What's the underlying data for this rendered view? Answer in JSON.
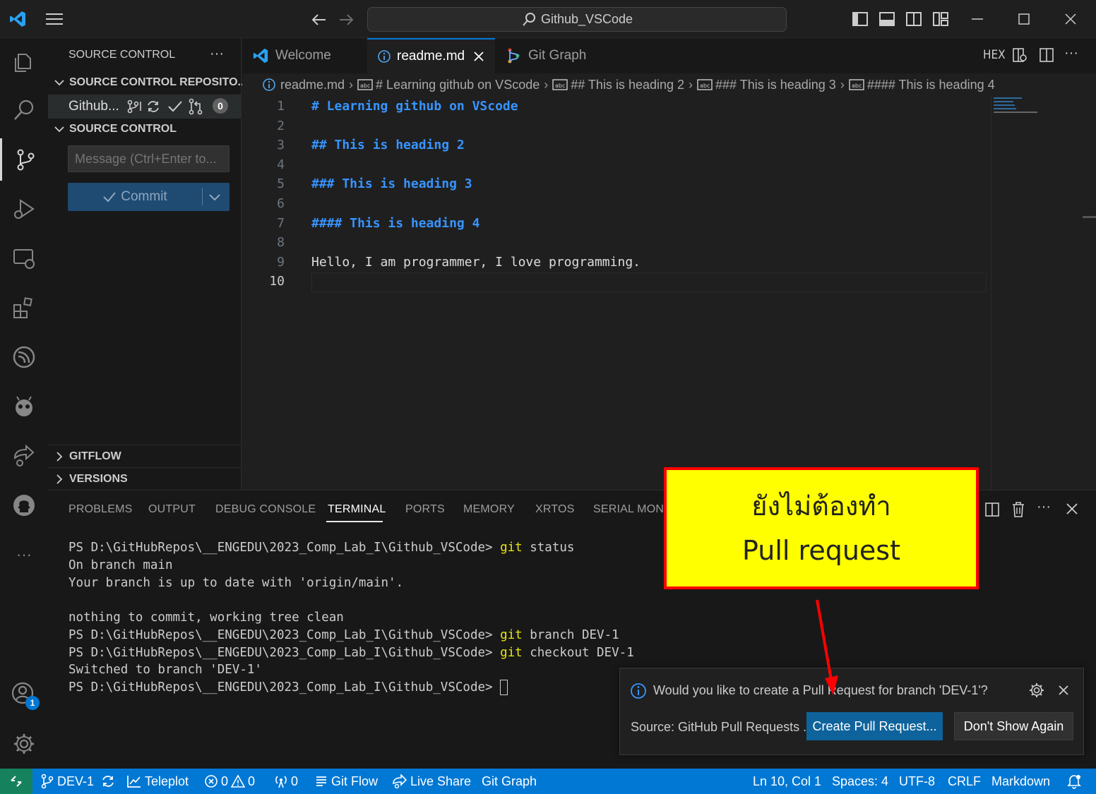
{
  "titlebar": {
    "search_text": "Github_VSCode"
  },
  "sidebar": {
    "title": "SOURCE CONTROL",
    "more": "···",
    "repos_header": "SOURCE CONTROL REPOSITO...",
    "repo_name": "Github...",
    "repo_badge": "0",
    "scm_header": "SOURCE CONTROL",
    "message_placeholder": "Message (Ctrl+Enter to...",
    "commit_label": "Commit",
    "gitflow": "GITFLOW",
    "versions": "VERSIONS"
  },
  "tabs": [
    {
      "label": "Welcome"
    },
    {
      "label": "readme.md"
    },
    {
      "label": "Git Graph"
    }
  ],
  "editor_actions": {
    "hex": "HEX"
  },
  "breadcrumb": {
    "file": "readme.md",
    "h1": "# Learning github on VScode",
    "h2": "## This is heading 2",
    "h3": "### This is heading 3",
    "h4": "#### This is heading 4"
  },
  "code_lines": [
    {
      "num": "1",
      "text": "# Learning github on VScode"
    },
    {
      "num": "2",
      "text": ""
    },
    {
      "num": "3",
      "text": "## This is heading 2"
    },
    {
      "num": "4",
      "text": ""
    },
    {
      "num": "5",
      "text": "### This is heading 3"
    },
    {
      "num": "6",
      "text": ""
    },
    {
      "num": "7",
      "text": "#### This is heading 4"
    },
    {
      "num": "8",
      "text": ""
    },
    {
      "num": "9",
      "text": "Hello, I am programmer, I love programming."
    },
    {
      "num": "10",
      "text": ""
    }
  ],
  "panel": {
    "tabs": [
      "PROBLEMS",
      "OUTPUT",
      "DEBUG CONSOLE",
      "TERMINAL",
      "PORTS",
      "MEMORY",
      "XRTOS",
      "SERIAL MONIT"
    ],
    "more": "···"
  },
  "terminal": {
    "prompt": "PS D:\\GitHubRepos\\__ENGEDU\\2023_Comp_Lab_I\\Github_VSCode>",
    "git": "git",
    "cmd1_rest": " status",
    "out1": "On branch main",
    "out2": "Your branch is up to date with 'origin/main'.",
    "out3": "nothing to commit, working tree clean",
    "cmd2_rest": " branch DEV-1",
    "cmd3_rest": " checkout DEV-1",
    "out4": "Switched to branch 'DEV-1'"
  },
  "callout": {
    "line1": "ยังไม่ต้องทำ",
    "line2": "Pull request"
  },
  "notification": {
    "message": "Would you like to create a Pull Request for branch 'DEV-1'?",
    "source": "Source: GitHub Pull Requests ...",
    "primary": "Create Pull Request...",
    "secondary": "Don't Show Again"
  },
  "statusbar": {
    "branch": "DEV-1",
    "teleplot": "Teleplot",
    "errors": "0",
    "warnings": "0",
    "ports": "0",
    "gitflow": "Git Flow",
    "liveshare": "Live Share",
    "gitgraph": "Git Graph",
    "position": "Ln 10, Col 1",
    "spaces": "Spaces: 4",
    "encoding": "UTF-8",
    "eol": "CRLF",
    "language": "Markdown"
  },
  "accounts_badge": "1",
  "colors": {
    "accent": "#0078d4",
    "heading": "#3794ff",
    "callout_bg": "#ffff00",
    "callout_border": "#ff0000"
  }
}
